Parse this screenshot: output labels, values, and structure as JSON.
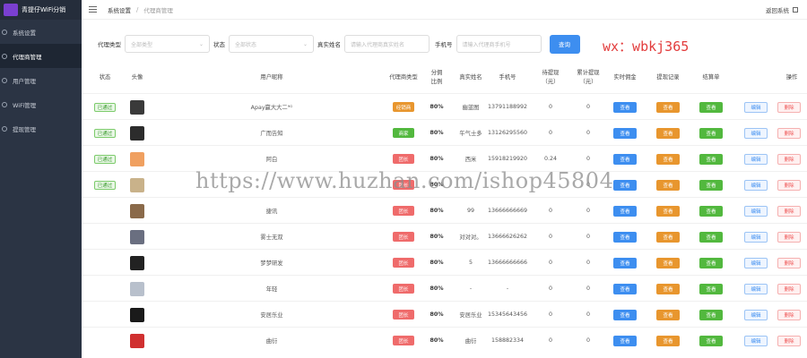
{
  "app": {
    "title": "青提仔WiFi分销"
  },
  "sidebar": {
    "items": [
      {
        "label": "系统设置",
        "active": false
      },
      {
        "label": "代理商管理",
        "active": true
      },
      {
        "label": "用户管理",
        "active": false
      },
      {
        "label": "WiFi管理",
        "active": false
      },
      {
        "label": "提现管理",
        "active": false
      }
    ]
  },
  "header": {
    "breadcrumb": [
      "系统设置",
      "代理商管理"
    ],
    "back_label": "返回系统"
  },
  "filters": {
    "agent_type_label": "代理类型",
    "agent_type_placeholder": "全部类型",
    "status_label": "状态",
    "status_placeholder": "全部状态",
    "realname_label": "真实姓名",
    "realname_placeholder": "请输入代理商真实姓名",
    "phone_label": "手机号",
    "phone_placeholder": "请输入代理商手机号",
    "query_button": "查询"
  },
  "contact": "wx：wbkj365",
  "watermark": "https://www.huzhan.com/ishop45804",
  "colors": {
    "sidebar_bg": "#2b3444",
    "primary": "#3d8ef0",
    "orange": "#e8962e",
    "green": "#52b83e",
    "red": "#ef6b6b"
  },
  "table": {
    "headers": {
      "status": "状态",
      "avatar": "头像",
      "nickname": "用户昵称",
      "agent_type": "代理商类型",
      "ratio": "分佣\n比例",
      "realname": "真实姓名",
      "phone": "手机号",
      "withdrawn": "待提现\n（元）",
      "total_withdrawn": "累计提现\n（元）",
      "commission": "实时佣金",
      "withdraw_records": "提现记录",
      "settlement": "结算单",
      "actions": "操作"
    },
    "labels": {
      "view": "查看",
      "edit": "编辑",
      "delete": "删除"
    },
    "rows": [
      {
        "status": "已通过",
        "avatar_color": "#3a3a3a",
        "nickname": "Apay赢大大二⁹ᴳ",
        "agent_type": "经销商",
        "type_color": "#e8962e",
        "ratio": "80%",
        "realname": "幽蓝图",
        "phone": "13791188992",
        "withdraw": "0",
        "total": "0"
      },
      {
        "status": "已通过",
        "avatar_color": "#2c2c2c",
        "nickname": "广而告知",
        "agent_type": "商家",
        "type_color": "#52b83e",
        "ratio": "80%",
        "realname": "午气士多",
        "phone": "13126295560",
        "withdraw": "0",
        "total": "0"
      },
      {
        "status": "已通过",
        "avatar_color": "#f0a060",
        "nickname": "阿白",
        "agent_type": "团长",
        "type_color": "#ef6b6b",
        "ratio": "80%",
        "realname": "西米",
        "phone": "15918219920",
        "withdraw": "0.24",
        "total": "0"
      },
      {
        "status": "已通过",
        "avatar_color": "#c9b28a",
        "nickname": "",
        "agent_type": "团长",
        "type_color": "#ef6b6b",
        "ratio": "80%",
        "realname": "",
        "phone": "",
        "withdraw": "",
        "total": "0"
      },
      {
        "status": "",
        "avatar_color": "#8a6a4a",
        "nickname": "捷讯",
        "agent_type": "团长",
        "type_color": "#ef6b6b",
        "ratio": "80%",
        "realname": "99",
        "phone": "13666666669",
        "withdraw": "0",
        "total": "0"
      },
      {
        "status": "",
        "avatar_color": "#6a6f80",
        "nickname": "雾士无双",
        "agent_type": "团长",
        "type_color": "#ef6b6b",
        "ratio": "80%",
        "realname": "对对对。",
        "phone": "13666626262",
        "withdraw": "0",
        "total": "0"
      },
      {
        "status": "",
        "avatar_color": "#222222",
        "nickname": "梦梦研发",
        "agent_type": "团长",
        "type_color": "#ef6b6b",
        "ratio": "80%",
        "realname": "5",
        "phone": "13666666666",
        "withdraw": "0",
        "total": "0"
      },
      {
        "status": "",
        "avatar_color": "#b8c0cc",
        "nickname": "年轻",
        "agent_type": "团长",
        "type_color": "#ef6b6b",
        "ratio": "80%",
        "realname": "-",
        "phone": "-",
        "withdraw": "0",
        "total": "0"
      },
      {
        "status": "",
        "avatar_color": "#1a1a1a",
        "nickname": "安居乐业",
        "agent_type": "团长",
        "type_color": "#ef6b6b",
        "ratio": "80%",
        "realname": "安居乐业",
        "phone": "15345643456",
        "withdraw": "0",
        "total": "0"
      },
      {
        "status": "",
        "avatar_color": "#d03030",
        "nickname": "曲衍",
        "agent_type": "团长",
        "type_color": "#ef6b6b",
        "ratio": "80%",
        "realname": "曲衍",
        "phone": "158882334",
        "withdraw": "0",
        "total": "0"
      }
    ]
  }
}
